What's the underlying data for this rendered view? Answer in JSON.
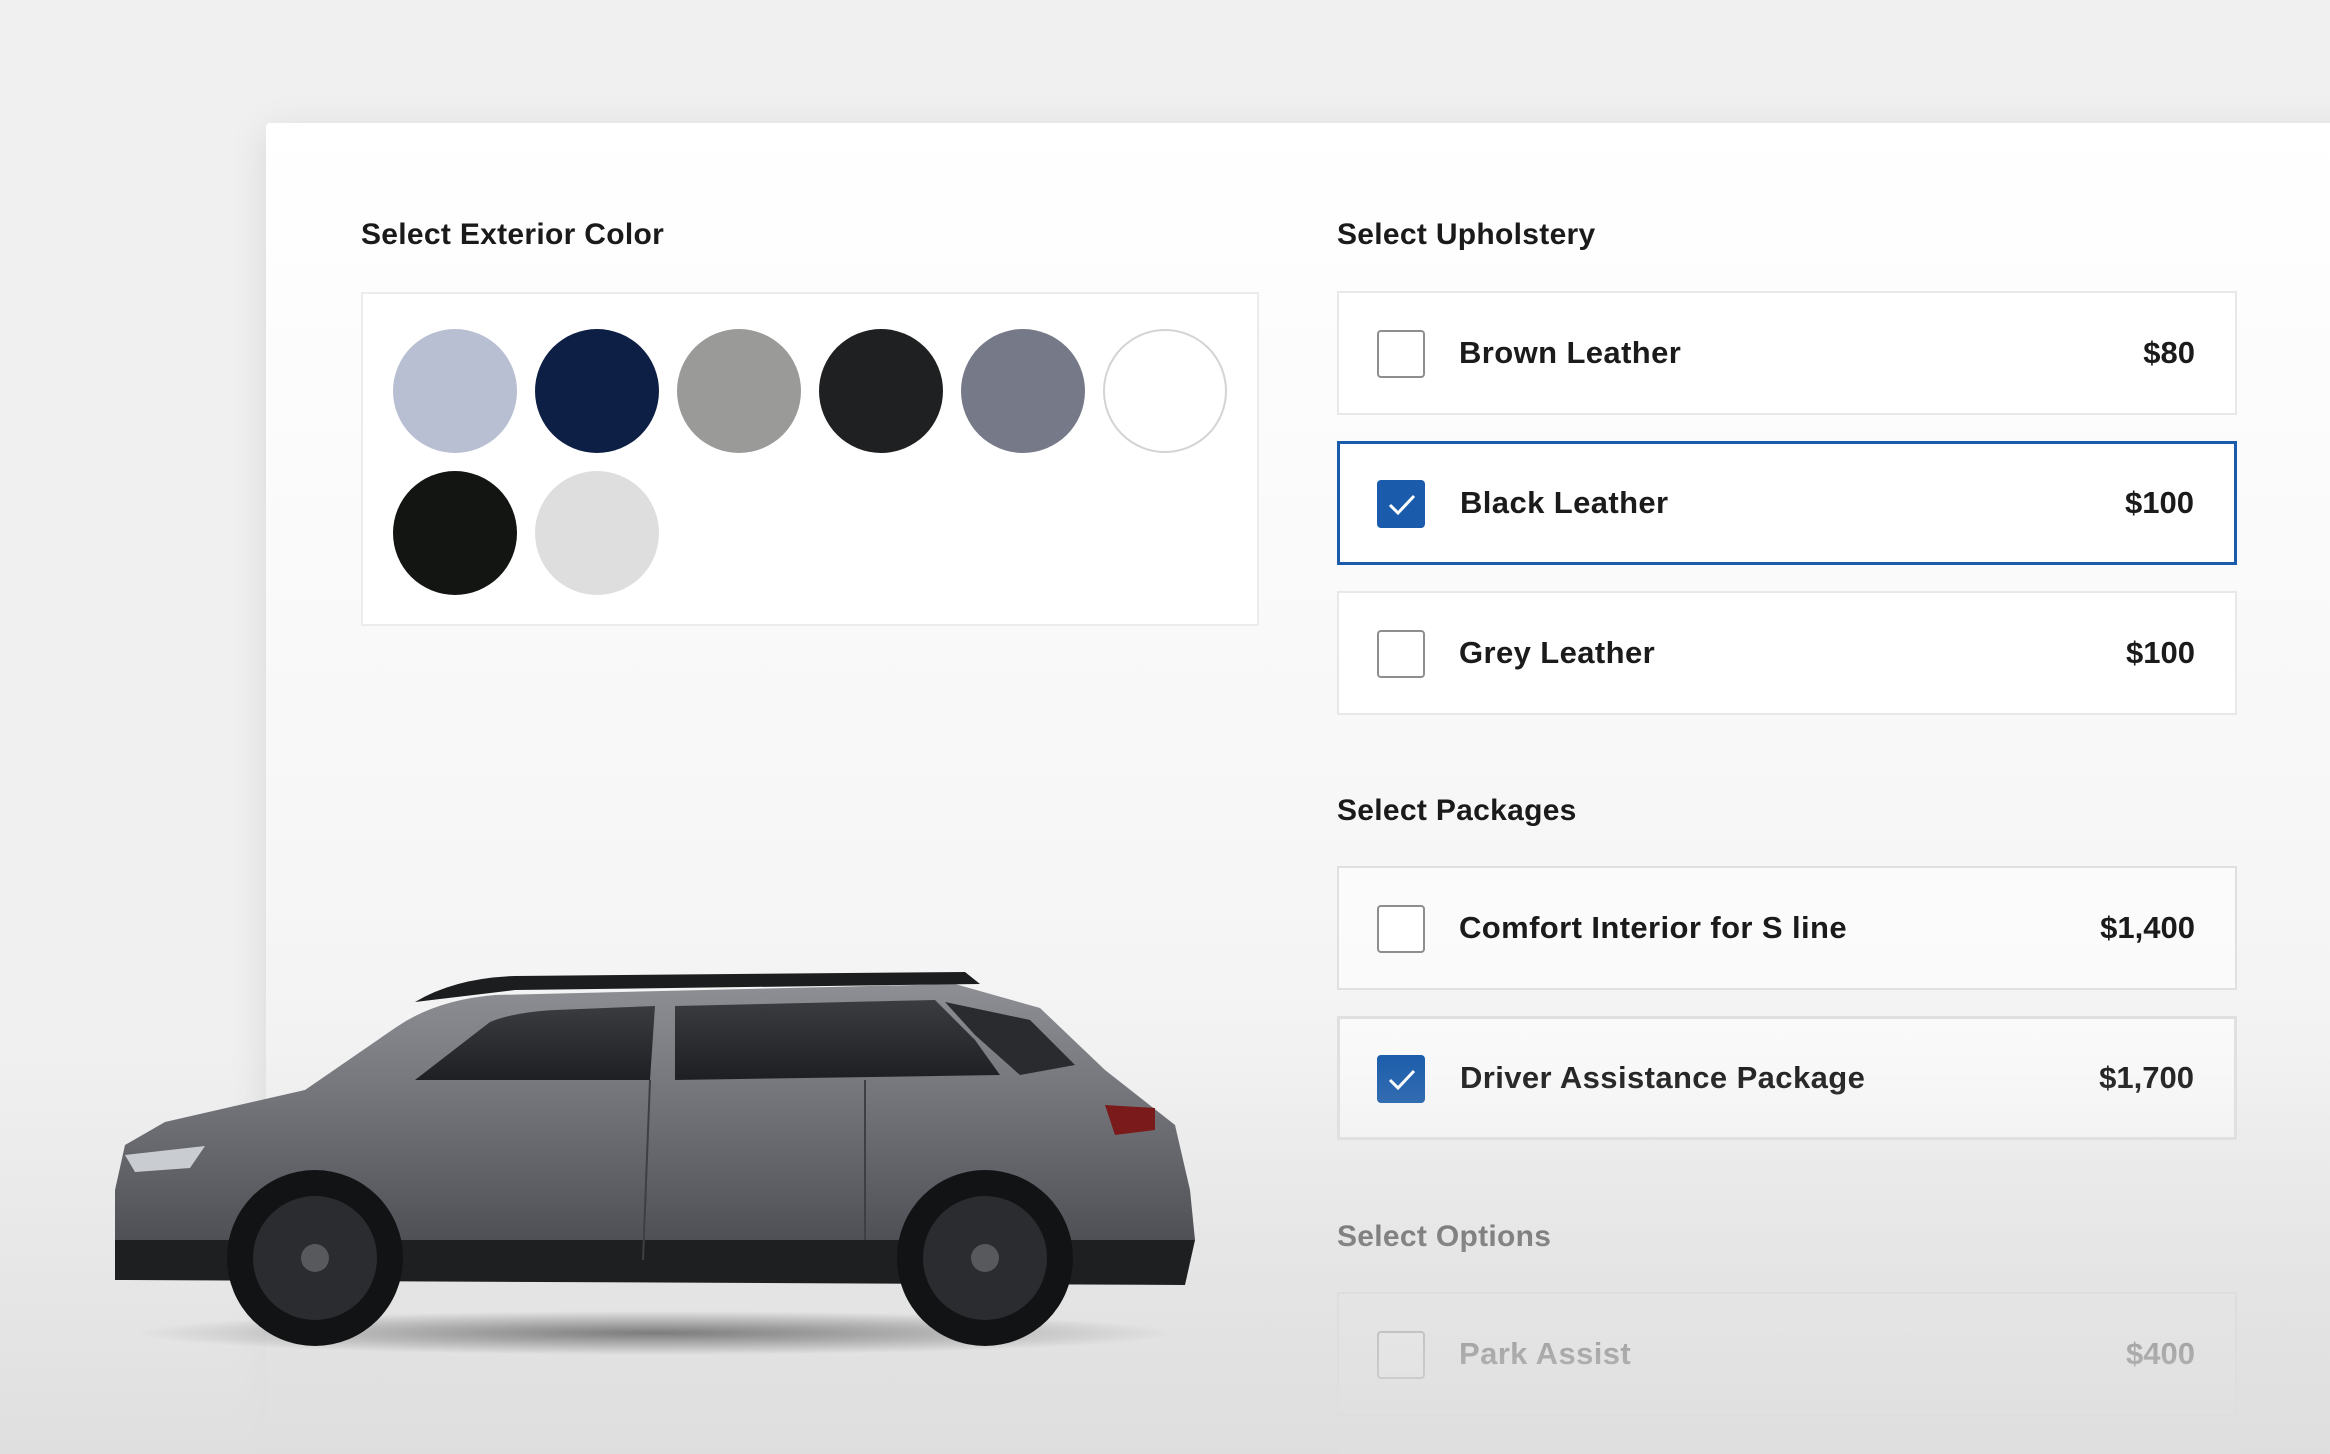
{
  "exterior": {
    "title": "Select Exterior Color",
    "swatches": [
      {
        "name": "light-blue-grey",
        "color": "#b9bfd2"
      },
      {
        "name": "navy-blue",
        "color": "#0d1f45"
      },
      {
        "name": "medium-grey",
        "color": "#9a9a99"
      },
      {
        "name": "charcoal",
        "color": "#1f2021"
      },
      {
        "name": "slate-grey",
        "color": "#767a88",
        "selected": true
      },
      {
        "name": "white",
        "color": "#ffffff"
      },
      {
        "name": "deep-black",
        "color": "#121512"
      },
      {
        "name": "light-silver",
        "color": "#dedede"
      }
    ],
    "selected_index": 4
  },
  "upholstery": {
    "title": "Select Upholstery",
    "items": [
      {
        "label": "Brown Leather",
        "price": "$80",
        "checked": false
      },
      {
        "label": "Black Leather",
        "price": "$100",
        "checked": true
      },
      {
        "label": "Grey Leather",
        "price": "$100",
        "checked": false
      }
    ]
  },
  "packages": {
    "title": "Select Packages",
    "items": [
      {
        "label": "Comfort Interior for S line",
        "price": "$1,400",
        "checked": false
      },
      {
        "label": "Driver Assistance Package",
        "price": "$1,700",
        "checked": true
      }
    ]
  },
  "options": {
    "title": "Select Options",
    "items": [
      {
        "label": "Park Assist",
        "price": "$400",
        "checked": false
      }
    ]
  },
  "colors": {
    "accent": "#1a5cab",
    "text": "#1b1b1b",
    "border": "#e8e8e8"
  }
}
